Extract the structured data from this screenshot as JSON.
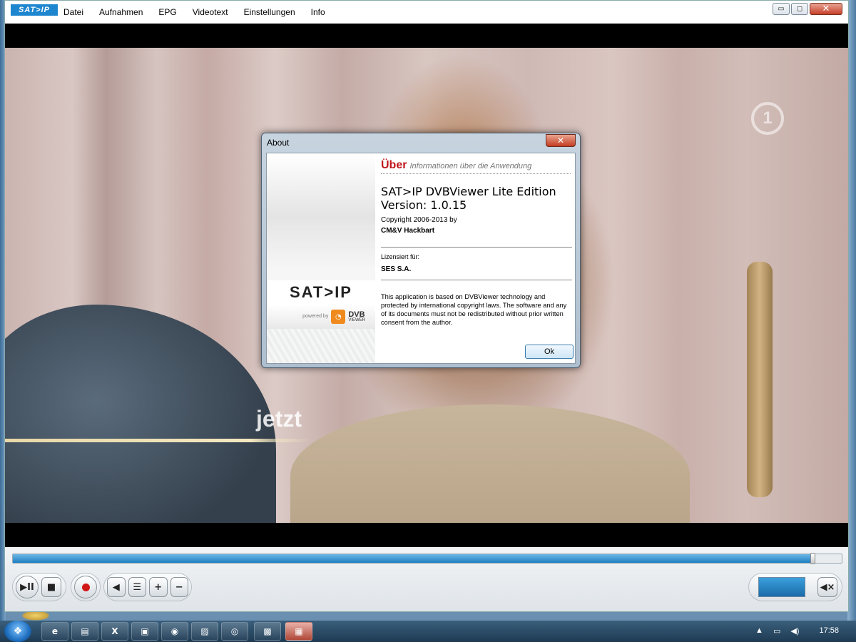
{
  "app": {
    "logo": "SAT>IP",
    "menu": [
      "Datei",
      "Aufnahmen",
      "EPG",
      "Videotext",
      "Einstellungen",
      "Info"
    ],
    "window_buttons": {
      "minimize": "▭",
      "maximize": "◻",
      "close": "✕"
    }
  },
  "video": {
    "channel_logo": "1",
    "overlay_text": "jetzt"
  },
  "controls": {
    "seek_progress": 0.965,
    "play_pause": "▶II",
    "stop": "■",
    "prev": "◀",
    "list": "☰",
    "plus": "+",
    "minus": "−",
    "mute": "◀×",
    "volume_level": 1.0
  },
  "about": {
    "title": "About",
    "close": "✕",
    "header": "Über",
    "header_sub": "Informationen über die Anwendung",
    "product_name": "SAT>IP DVBViewer Lite Edition",
    "version": "Version: 1.0.15",
    "copyright": "Copyright 2006-2013 by",
    "company": "CM&V Hackbart",
    "licensed_label": "Lizensiert für:",
    "licensee": "SES S.A.",
    "legal": "This application is based on DVBViewer technology and protected by international copyright laws. The software and any of its documents must not be redistributed without prior written consent from the author.",
    "ok_label": "Ok",
    "side_logo": "SAT>IP",
    "powered": "powered by",
    "dvb": "DVB",
    "dvb_sub": "VIEWER"
  },
  "taskbar": {
    "items": [
      "e",
      "▤",
      "X",
      "▣",
      "◉",
      "▨",
      "◎",
      "▩",
      "▦"
    ],
    "clock": "17:58",
    "tray_icons": [
      "▲",
      "▭",
      "◀)"
    ]
  },
  "colors": {
    "accent": "#1e86cf",
    "close_red": "#c33c22",
    "header_red": "#c0141a",
    "seek_blue": "#1f7fc2"
  }
}
